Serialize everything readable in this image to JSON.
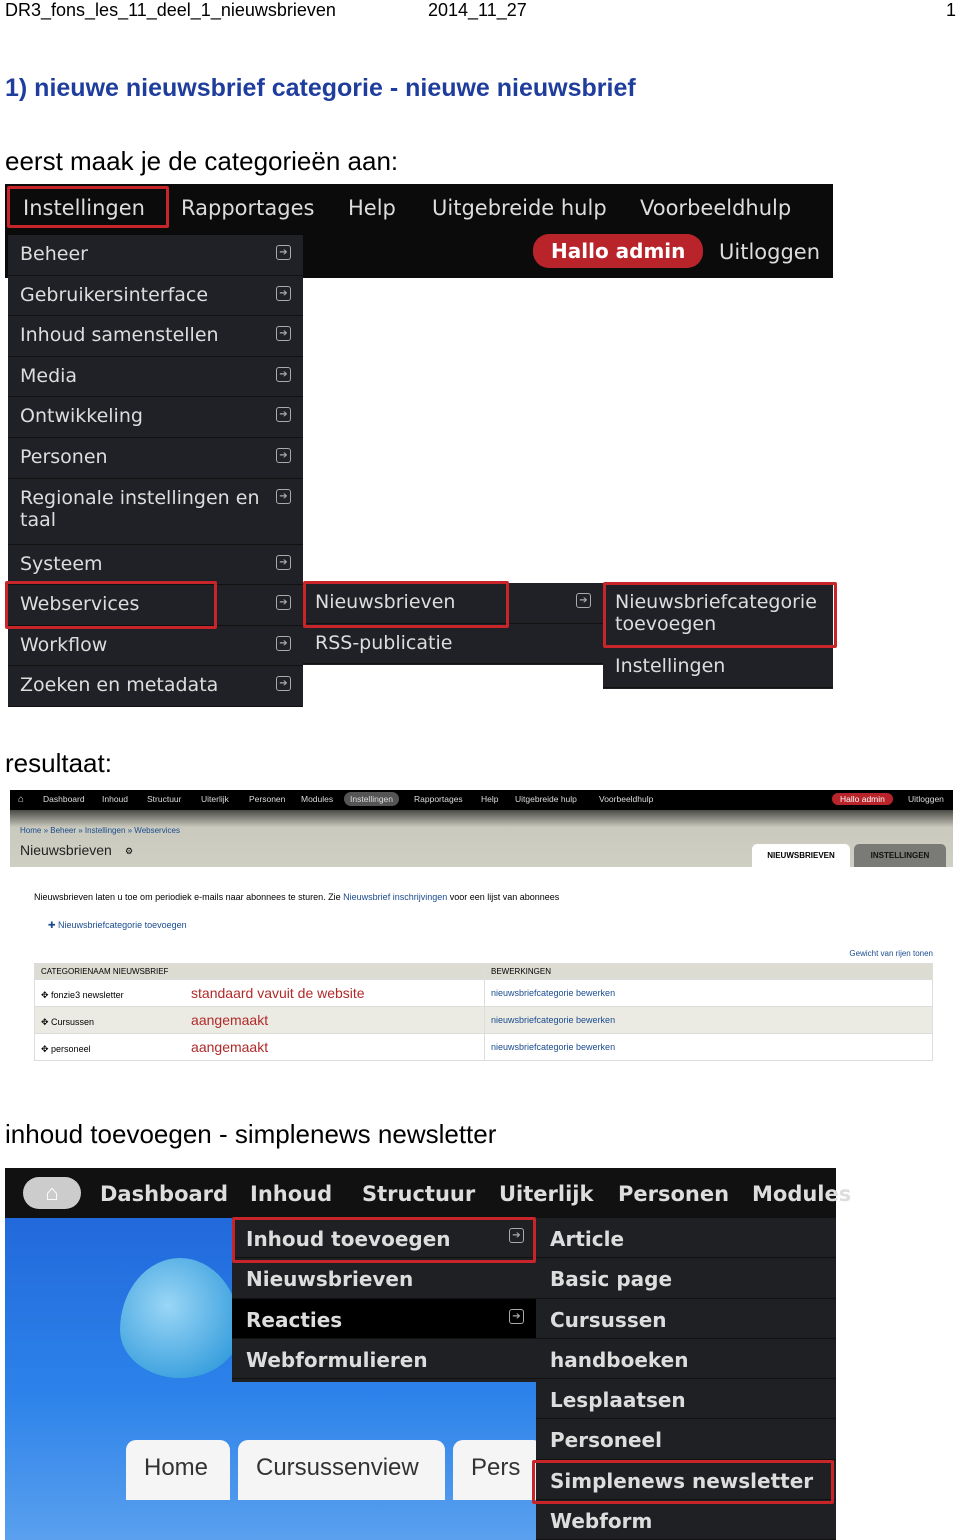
{
  "header": {
    "left": "DR3_fons_les_11_deel_1_nieuwsbrieven",
    "date": "2014_11_27",
    "page": "1"
  },
  "heading": "1) nieuwe nieuwsbrief categorie  -  nieuwe nieuwsbrief",
  "intro": "eerst maak je de categorieën aan:",
  "shot1": {
    "topmenu": [
      "Instellingen",
      "Rapportages",
      "Help",
      "Uitgebreide hulp",
      "Voorbeeldhulp"
    ],
    "hallo": "Hallo admin",
    "logout": "Uitloggen",
    "menu": [
      "Beheer",
      "Gebruikersinterface",
      "Inhoud samenstellen",
      "Media",
      "Ontwikkeling",
      "Personen",
      "Regionale instellingen en taal",
      "Systeem",
      "Webservices",
      "Workflow",
      "Zoeken en metadata"
    ],
    "sub": [
      "Nieuwsbrieven",
      "RSS-publicatie"
    ],
    "sub2": [
      "Nieuwsbriefcategorie toevoegen",
      "Instellingen"
    ]
  },
  "result_label": "resultaat:",
  "shot2": {
    "nav": [
      "Dashboard",
      "Inhoud",
      "Structuur",
      "Uiterlijk",
      "Personen",
      "Modules",
      "Instellingen",
      "Rapportages",
      "Help",
      "Uitgebreide hulp",
      "Voorbeeldhulp"
    ],
    "hallo": "Hallo admin",
    "logout": "Uitloggen",
    "breadcrumb": "Home » Beheer » Instellingen » Webservices",
    "title": "Nieuwsbrieven",
    "tabs": [
      "NIEUWSBRIEVEN",
      "INSTELLINGEN"
    ],
    "desc_pre": "Nieuwsbrieven laten u toe om periodiek e-mails naar abonnees te sturen. Zie ",
    "desc_link": "Nieuwsbrief inschrijvingen",
    "desc_post": " voor een lijst van abonnees",
    "add": "Nieuwsbriefcategorie toevoegen",
    "weights": "Gewicht van rijen tonen",
    "columns": [
      "CATEGORIENAAM NIEUWSBRIEF",
      "BEWERKINGEN"
    ],
    "rows": [
      {
        "name": "fonzie3 newsletter",
        "note": "standaard vavuit de website",
        "action": "nieuwsbriefcategorie bewerken"
      },
      {
        "name": "Cursussen",
        "note": "aangemaakt",
        "action": "nieuwsbriefcategorie bewerken"
      },
      {
        "name": "personeel",
        "note": "aangemaakt",
        "action": "nieuwsbriefcategorie bewerken"
      }
    ]
  },
  "section3": "inhoud toevoegen  -  simplenews newsletter",
  "shot3": {
    "nav": [
      "Dashboard",
      "Inhoud",
      "Structuur",
      "Uiterlijk",
      "Personen",
      "Modules"
    ],
    "menu": [
      "Inhoud toevoegen",
      "Nieuwsbrieven",
      "Reacties",
      "Webformulieren"
    ],
    "types": [
      "Article",
      "Basic page",
      "Cursussen",
      "handboeken",
      "Lesplaatsen",
      "Personeel",
      "Simplenews newsletter",
      "Webform"
    ],
    "tabs": [
      "Home",
      "Cursussenview",
      "Pers"
    ]
  },
  "colors": {
    "heading": "#1f3d9c",
    "highlight": "#c8252a",
    "annotation": "#b02a2a",
    "link": "#1a4b8f"
  }
}
